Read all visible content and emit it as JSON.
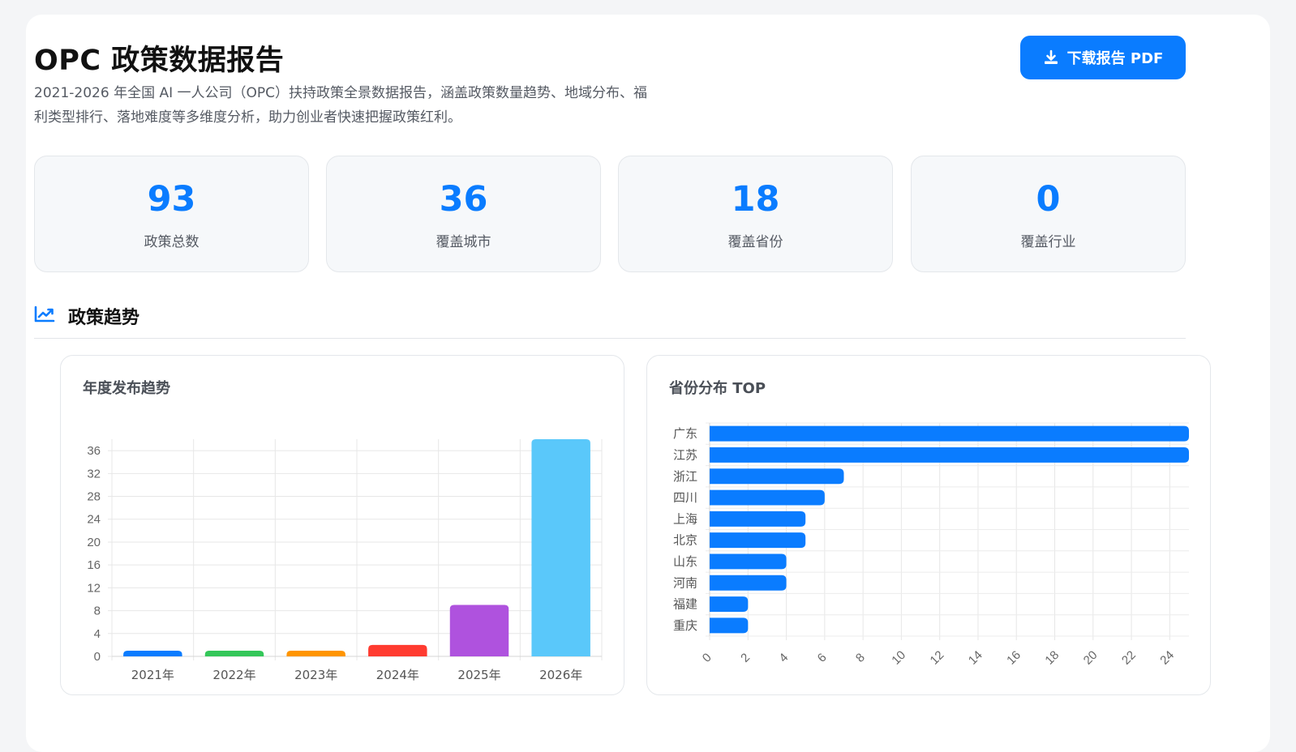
{
  "header": {
    "title": "OPC 政策数据报告",
    "description": "2021-2026 年全国 AI 一人公司（OPC）扶持政策全景数据报告，涵盖政策数量趋势、地域分布、福利类型排行、落地难度等多维度分析，助力创业者快速把握政策红利。",
    "download_label": "下载报告 PDF",
    "download_icon": "download-icon"
  },
  "stats": [
    {
      "value": "93",
      "label": "政策总数"
    },
    {
      "value": "36",
      "label": "覆盖城市"
    },
    {
      "value": "18",
      "label": "覆盖省份"
    },
    {
      "value": "0",
      "label": "覆盖行业"
    }
  ],
  "section": {
    "title": "政策趋势",
    "icon": "trend-chart-icon"
  },
  "chart_data": [
    {
      "type": "bar",
      "title": "年度发布趋势",
      "categories": [
        "2021年",
        "2022年",
        "2023年",
        "2024年",
        "2025年",
        "2026年"
      ],
      "values": [
        1,
        1,
        1,
        2,
        9,
        38
      ],
      "colors": [
        "#0a7cff",
        "#34c759",
        "#ff9500",
        "#ff3b30",
        "#af52de",
        "#5ac8fa"
      ],
      "ylim": [
        0,
        38
      ],
      "yticks": [
        0,
        4,
        8,
        12,
        16,
        20,
        24,
        28,
        32,
        36
      ],
      "grid": true
    },
    {
      "type": "bar",
      "orientation": "horizontal",
      "title": "省份分布 TOP",
      "categories": [
        "广东",
        "江苏",
        "浙江",
        "四川",
        "上海",
        "北京",
        "山东",
        "河南",
        "福建",
        "重庆"
      ],
      "values": [
        25,
        25,
        7,
        6,
        5,
        5,
        4,
        4,
        2,
        2
      ],
      "color": "#0a7cff",
      "xlim": [
        0,
        25
      ],
      "xticks": [
        0,
        2,
        4,
        6,
        8,
        10,
        12,
        14,
        16,
        18,
        20,
        22,
        24
      ],
      "grid": true
    }
  ]
}
